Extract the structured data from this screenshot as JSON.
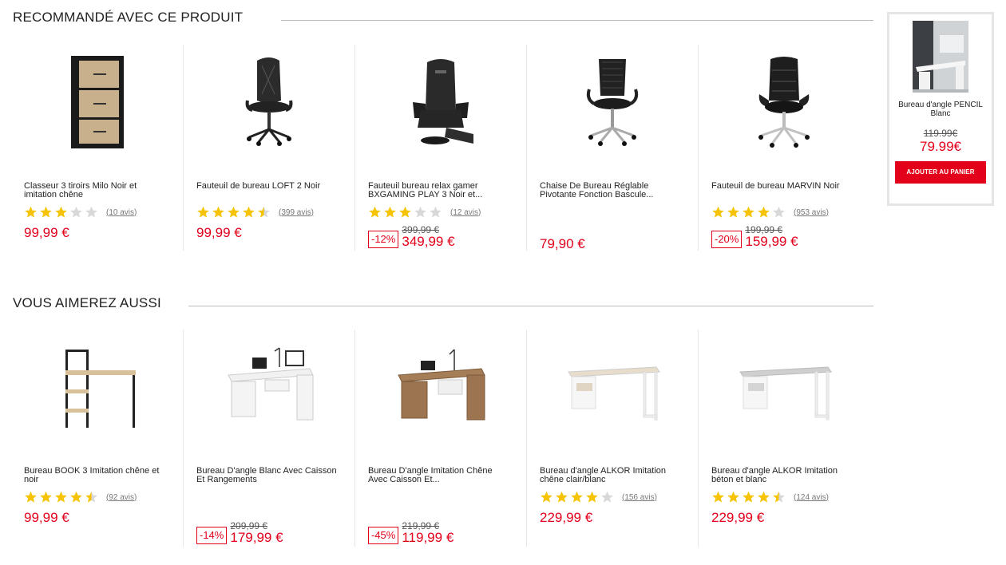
{
  "colors": {
    "accent": "#e2001a",
    "star": "#f5c300",
    "star_empty": "#d8d8d8"
  },
  "section1": {
    "title": "RECOMMANDÉ AVEC CE PRODUIT",
    "products": [
      {
        "name": "Classeur 3 tiroirs Milo Noir et imitation chêne",
        "rating": 3,
        "reviews": "(10 avis)",
        "price": "99,99 €",
        "image_icon": "filing-cabinet-icon"
      },
      {
        "name": "Fauteuil de bureau LOFT 2 Noir",
        "rating": 4.5,
        "reviews": "(399 avis)",
        "price": "99,99 €",
        "image_icon": "office-chair-icon"
      },
      {
        "name": "Fauteuil bureau relax gamer BXGAMING PLAY 3 Noir et...",
        "rating": 3,
        "reviews": "(12 avis)",
        "discount": "-12%",
        "old_price": "399,99 €",
        "price": "349,99 €",
        "image_icon": "gaming-chair-icon"
      },
      {
        "name": "Chaise De Bureau Réglable Pivotante Fonction Bascule...",
        "price": "79,90 €",
        "image_icon": "mesh-chair-icon"
      },
      {
        "name": "Fauteuil de bureau MARVIN Noir",
        "rating": 4,
        "reviews": "(953 avis)",
        "discount": "-20%",
        "old_price": "199,99 €",
        "price": "159,99 €",
        "image_icon": "executive-chair-icon"
      }
    ]
  },
  "section2": {
    "title": "VOUS AIMEREZ AUSSI",
    "products": [
      {
        "name": "Bureau BOOK 3 Imitation chêne et noir",
        "rating": 4.5,
        "reviews": "(92 avis)",
        "price": "99,99 €",
        "image_icon": "desk-shelf-icon"
      },
      {
        "name": "Bureau D'angle Blanc Avec Caisson Et Rangements",
        "discount": "-14%",
        "old_price": "209,99 €",
        "price": "179,99 €",
        "image_icon": "corner-desk-white-icon"
      },
      {
        "name": "Bureau D'angle Imitation Chêne Avec Caisson Et...",
        "discount": "-45%",
        "old_price": "219,99 €",
        "price": "119,99 €",
        "image_icon": "corner-desk-oak-icon"
      },
      {
        "name": "Bureau d'angle ALKOR Imitation chêne clair/blanc",
        "rating": 4,
        "reviews": "(156 avis)",
        "price": "229,99 €",
        "image_icon": "corner-desk-light-icon"
      },
      {
        "name": "Bureau d'angle ALKOR Imitation béton et blanc",
        "rating": 4.5,
        "reviews": "(124 avis)",
        "price": "229,99 €",
        "image_icon": "corner-desk-concrete-icon"
      }
    ]
  },
  "sidebar": {
    "name": "Bureau d'angle PENCIL Blanc",
    "old_price": "119.99€",
    "price": "79.99€",
    "button": "AJOUTER AU PANIER",
    "image_icon": "desk-photo-icon"
  }
}
